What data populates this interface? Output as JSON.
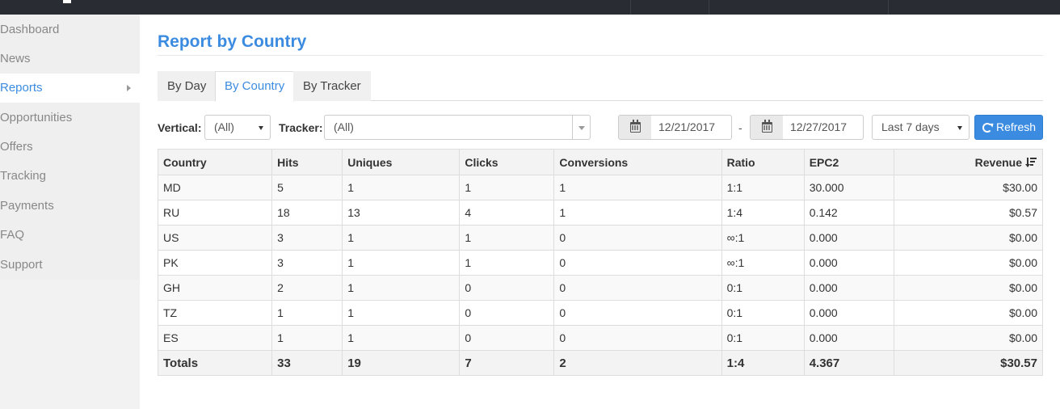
{
  "sidebar": {
    "items": [
      {
        "label": "Dashboard"
      },
      {
        "label": "News"
      },
      {
        "label": "Reports"
      },
      {
        "label": "Opportunities"
      },
      {
        "label": "Offers"
      },
      {
        "label": "Tracking"
      },
      {
        "label": "Payments"
      },
      {
        "label": "FAQ"
      },
      {
        "label": "Support"
      }
    ],
    "active_item": "Reports"
  },
  "main": {
    "title": "Report by Country",
    "tabs": [
      {
        "label": "By Day"
      },
      {
        "label": "By Country"
      },
      {
        "label": "By Tracker"
      }
    ],
    "active_tab": "By Country"
  },
  "filters": {
    "vertical_label": "Vertical:",
    "vertical_value": "(All)",
    "tracker_label": "Tracker:",
    "tracker_value": "(All)",
    "date_from": "12/21/2017",
    "date_separator": "-",
    "date_to": "12/27/2017",
    "range_value": "Last 7 days",
    "refresh_label": "Refresh"
  },
  "table": {
    "headers": [
      "Country",
      "Hits",
      "Uniques",
      "Clicks",
      "Conversions",
      "Ratio",
      "EPC2",
      "Revenue"
    ],
    "rows": [
      [
        "MD",
        "5",
        "1",
        "1",
        "1",
        "1:1",
        "30.000",
        "$30.00"
      ],
      [
        "RU",
        "18",
        "13",
        "4",
        "1",
        "1:4",
        "0.142",
        "$0.57"
      ],
      [
        "US",
        "3",
        "1",
        "1",
        "0",
        "∞:1",
        "0.000",
        "$0.00"
      ],
      [
        "PK",
        "3",
        "1",
        "1",
        "0",
        "∞:1",
        "0.000",
        "$0.00"
      ],
      [
        "GH",
        "2",
        "1",
        "0",
        "0",
        "0:1",
        "0.000",
        "$0.00"
      ],
      [
        "TZ",
        "1",
        "1",
        "0",
        "0",
        "0:1",
        "0.000",
        "$0.00"
      ],
      [
        "ES",
        "1",
        "1",
        "0",
        "0",
        "0:1",
        "0.000",
        "$0.00"
      ]
    ],
    "totals": [
      "Totals",
      "33",
      "19",
      "7",
      "2",
      "1:4",
      "4.367",
      "$30.57"
    ],
    "sort_column": "Revenue",
    "sort_direction": "descending"
  },
  "colors": {
    "accent": "#3b8be0",
    "topbar": "#2a2c33"
  }
}
